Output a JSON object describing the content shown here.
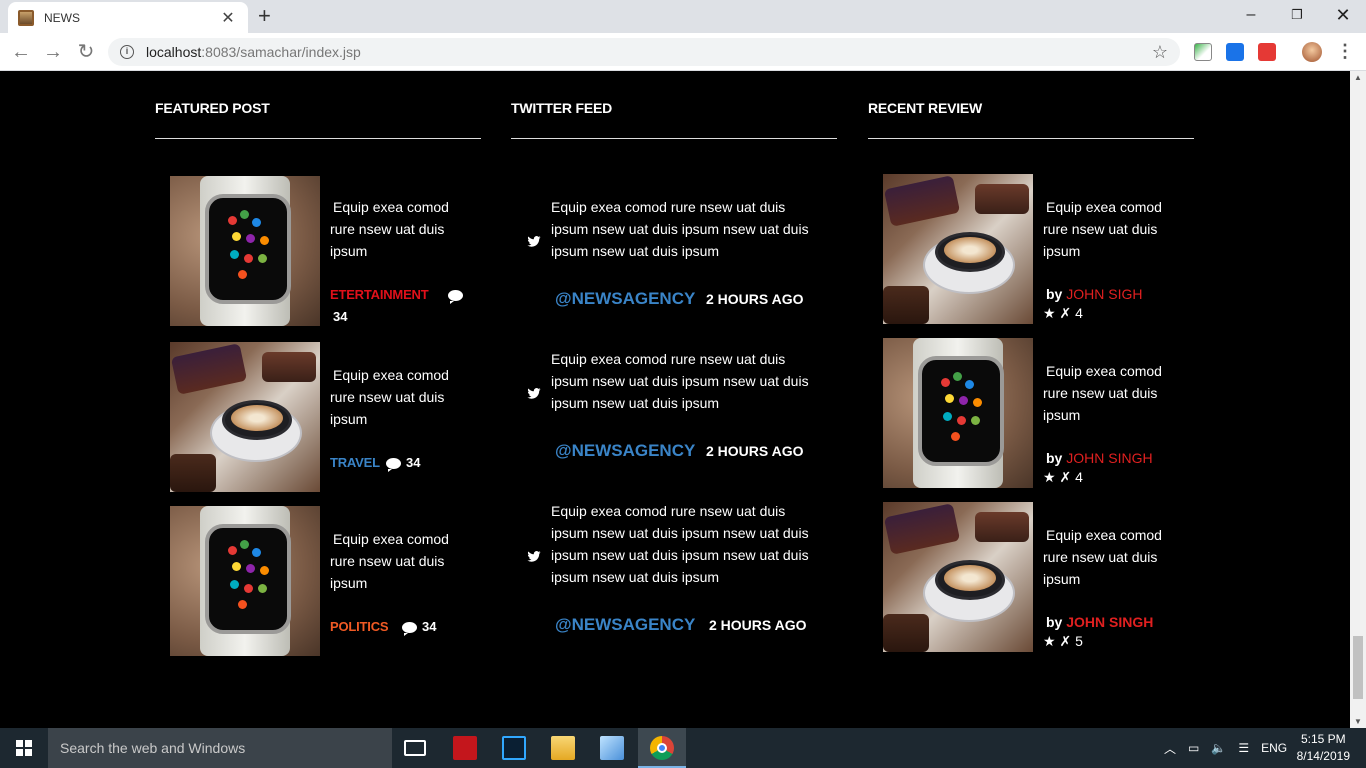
{
  "browser": {
    "tab_title": "NEWS",
    "url_host": "localhost",
    "url_rest": ":8083/samachar/index.jsp"
  },
  "columns": {
    "featured": {
      "heading": "FEATURED POST",
      "items": [
        {
          "lines": [
            "Equip exea comod",
            "rure  nsew uat duis",
            "ipsum"
          ],
          "category": "ETERTAINMENT",
          "category_color": "#e0101a",
          "comments": "34",
          "image": "watch"
        },
        {
          "lines": [
            "Equip exea comod",
            "rure  nsew uat duis",
            "ipsum"
          ],
          "category": "TRAVEL",
          "category_color": "#3a84c7",
          "comments": "34",
          "image": "coffee"
        },
        {
          "lines": [
            "Equip exea comod",
            "rure  nsew uat duis",
            "ipsum"
          ],
          "category": "POLITICS",
          "category_color": "#f05a24",
          "comments": "34",
          "image": "watch"
        }
      ]
    },
    "twitter": {
      "heading": "TWITTER FEED",
      "items": [
        {
          "lines": [
            " Equip exea comod rure  nsew uat duis",
            "ipsum nsew uat duis ipsum nsew uat duis",
            "ipsum nsew uat duis ipsum"
          ],
          "handle": "@NEWSAGENCY",
          "ago": "2 HOURS AGO"
        },
        {
          "lines": [
            " Equip exea comod rure  nsew uat duis",
            "ipsum nsew uat duis ipsum nsew uat duis",
            "ipsum nsew uat duis ipsum"
          ],
          "handle": "@NEWSAGENCY",
          "ago": "2 HOURS AGO"
        },
        {
          "lines": [
            "Equip exea comod rure nsew uat duis",
            "ipsum nsew uat duis ipsum nsew uat duis",
            "ipsum nsew uat duis ipsum nsew uat duis",
            "ipsum nsew uat duis ipsum"
          ],
          "handle": "@NEWSAGENCY",
          "ago": "2 HOURS AGO"
        }
      ]
    },
    "review": {
      "heading": "RECENT REVIEW",
      "items": [
        {
          "lines": [
            "Equip exea comod",
            "rure  nsew uat duis",
            "ipsum"
          ],
          "by": "by",
          "author": "JOHN SIGH",
          "rating": "4",
          "image": "coffee"
        },
        {
          "lines": [
            "Equip exea comod",
            "rure  nsew uat duis",
            "ipsum"
          ],
          "by": "by",
          "author": "JOHN SINGH",
          "rating": "4",
          "image": "watch"
        },
        {
          "lines": [
            "Equip exea comod",
            "rure  nsew uat duis",
            "ipsum"
          ],
          "by": "by",
          "author": "JOHN SINGH",
          "rating": "5",
          "image": "coffee"
        }
      ]
    }
  },
  "taskbar": {
    "search_placeholder": "Search the web and Windows",
    "lang": "ENG",
    "time": "5:15 PM",
    "date": "8/14/2019"
  }
}
